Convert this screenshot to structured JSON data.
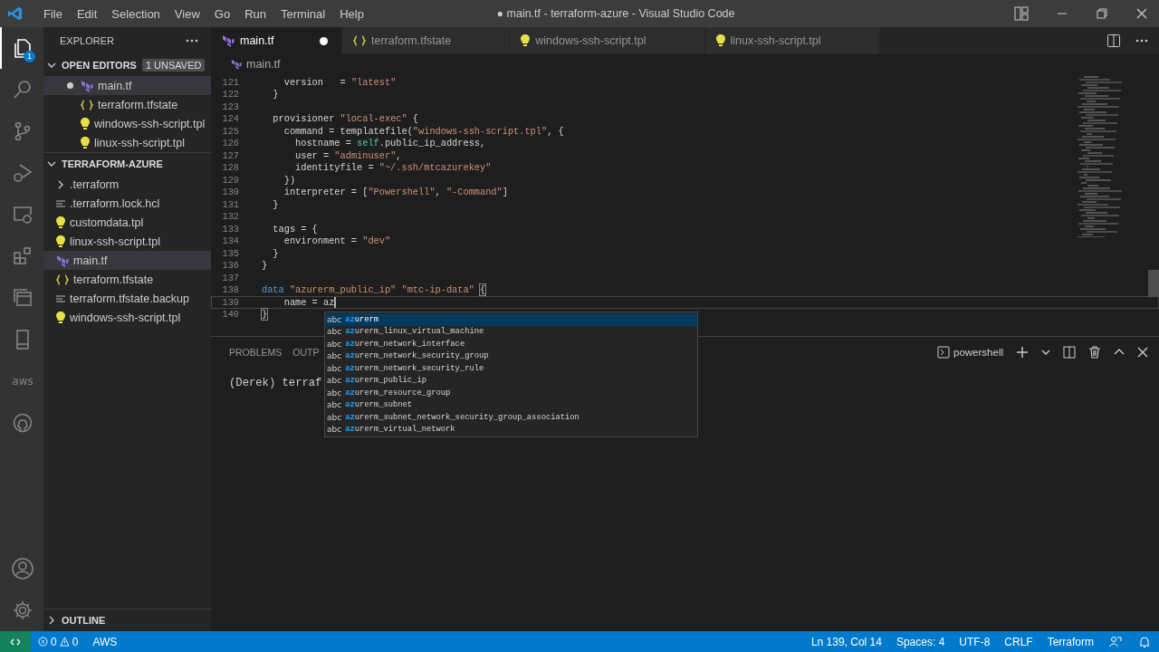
{
  "window": {
    "title": "● main.tf - terraform-azure - Visual Studio Code"
  },
  "menu": [
    "File",
    "Edit",
    "Selection",
    "View",
    "Go",
    "Run",
    "Terminal",
    "Help"
  ],
  "activity_bar": [
    {
      "kind": "explorer",
      "selected": true,
      "badge": "1"
    },
    {
      "kind": "search",
      "selected": false
    },
    {
      "kind": "source-control",
      "selected": false
    },
    {
      "kind": "run-debug",
      "selected": false
    },
    {
      "kind": "remote",
      "selected": false
    },
    {
      "kind": "extensions",
      "selected": false
    },
    {
      "kind": "panels",
      "selected": false
    },
    {
      "kind": "tablet",
      "selected": false
    },
    {
      "kind": "aws",
      "selected": false,
      "label": "aws"
    },
    {
      "kind": "github",
      "selected": false
    }
  ],
  "sidebar": {
    "title": "EXPLORER",
    "open_editors": {
      "title": "OPEN EDITORS",
      "badge": "1 UNSAVED",
      "expanded": true,
      "items": [
        {
          "name": "main.tf",
          "kind": "terraform",
          "unsaved": true,
          "selected": true
        },
        {
          "name": "terraform.tfstate",
          "kind": "json",
          "unsaved": false,
          "selected": false
        },
        {
          "name": "windows-ssh-script.tpl",
          "kind": "template",
          "unsaved": false,
          "selected": false
        },
        {
          "name": "linux-ssh-script.tpl",
          "kind": "template",
          "unsaved": false,
          "selected": false
        }
      ]
    },
    "folder": {
      "title": "TERRAFORM-AZURE",
      "expanded": true,
      "items": [
        {
          "name": ".terraform",
          "kind": "folder",
          "expanded": false,
          "selected": false
        },
        {
          "name": ".terraform.lock.hcl",
          "kind": "text",
          "selected": false
        },
        {
          "name": "customdata.tpl",
          "kind": "template",
          "selected": false
        },
        {
          "name": "linux-ssh-script.tpl",
          "kind": "template",
          "selected": false
        },
        {
          "name": "main.tf",
          "kind": "terraform",
          "selected": true
        },
        {
          "name": "terraform.tfstate",
          "kind": "json",
          "selected": false
        },
        {
          "name": "terraform.tfstate.backup",
          "kind": "text",
          "selected": false
        },
        {
          "name": "windows-ssh-script.tpl",
          "kind": "template",
          "selected": false
        }
      ]
    },
    "outline": {
      "title": "OUTLINE",
      "expanded": false
    }
  },
  "tabs": [
    {
      "name": "main.tf",
      "kind": "terraform",
      "selected": true,
      "unsaved": true
    },
    {
      "name": "terraform.tfstate",
      "kind": "json",
      "selected": false,
      "unsaved": false
    },
    {
      "name": "windows-ssh-script.tpl",
      "kind": "template",
      "selected": false,
      "unsaved": false
    },
    {
      "name": "linux-ssh-script.tpl",
      "kind": "template",
      "selected": false,
      "unsaved": false
    }
  ],
  "breadcrumb": {
    "name": "main.tf",
    "kind": "terraform"
  },
  "code": [
    {
      "number": "121",
      "current": false,
      "tokens": [
        {
          "kind": "plain",
          "text": "    version   = "
        },
        {
          "kind": "string",
          "text": "\"latest\""
        }
      ]
    },
    {
      "number": "122",
      "current": false,
      "tokens": [
        {
          "kind": "plain",
          "text": "  }"
        }
      ]
    },
    {
      "number": "123",
      "current": false
    },
    {
      "number": "124",
      "current": false,
      "tokens": [
        {
          "kind": "plain",
          "text": "  provisioner "
        },
        {
          "kind": "string",
          "text": "\"local-exec\""
        },
        {
          "kind": "plain",
          "text": " {"
        }
      ]
    },
    {
      "number": "125",
      "current": false,
      "tokens": [
        {
          "kind": "plain",
          "text": "    command = templatefile("
        },
        {
          "kind": "string",
          "text": "\"windows-ssh-script.tpl\""
        },
        {
          "kind": "plain",
          "text": ", {"
        }
      ]
    },
    {
      "number": "126",
      "current": false,
      "tokens": [
        {
          "kind": "plain",
          "text": "      hostname = "
        },
        {
          "kind": "variable",
          "text": "self"
        },
        {
          "kind": "plain",
          "text": ".public_ip_address,"
        }
      ]
    },
    {
      "number": "127",
      "current": false,
      "tokens": [
        {
          "kind": "plain",
          "text": "      user = "
        },
        {
          "kind": "string",
          "text": "\"adminuser\""
        },
        {
          "kind": "plain",
          "text": ","
        }
      ]
    },
    {
      "number": "128",
      "current": false,
      "tokens": [
        {
          "kind": "plain",
          "text": "      identityfile = "
        },
        {
          "kind": "string",
          "text": "\"~/.ssh/mtcazurekey\""
        }
      ]
    },
    {
      "number": "129",
      "current": false,
      "tokens": [
        {
          "kind": "plain",
          "text": "    })"
        }
      ]
    },
    {
      "number": "130",
      "current": false,
      "tokens": [
        {
          "kind": "plain",
          "text": "    interpreter = ["
        },
        {
          "kind": "string",
          "text": "\"Powershell\""
        },
        {
          "kind": "plain",
          "text": ", "
        },
        {
          "kind": "string",
          "text": "\"-Command\""
        },
        {
          "kind": "plain",
          "text": "]"
        }
      ]
    },
    {
      "number": "131",
      "current": false,
      "tokens": [
        {
          "kind": "plain",
          "text": "  }"
        }
      ]
    },
    {
      "number": "132",
      "current": false
    },
    {
      "number": "133",
      "current": false,
      "tokens": [
        {
          "kind": "plain",
          "text": "  tags = {"
        }
      ]
    },
    {
      "number": "134",
      "current": false,
      "tokens": [
        {
          "kind": "plain",
          "text": "    environment = "
        },
        {
          "kind": "string",
          "text": "\"dev\""
        }
      ]
    },
    {
      "number": "135",
      "current": false,
      "tokens": [
        {
          "kind": "plain",
          "text": "  }"
        }
      ]
    },
    {
      "number": "136",
      "current": false,
      "tokens": [
        {
          "kind": "plain",
          "text": "}"
        }
      ]
    },
    {
      "number": "137",
      "current": false
    },
    {
      "number": "138",
      "current": false,
      "tokens": [
        {
          "kind": "keyword",
          "text": "data"
        },
        {
          "kind": "string",
          "text": " \"azurerm_public_ip\""
        },
        {
          "kind": "string",
          "text": " \"mtc-ip-data\" "
        },
        {
          "kind": "bracket",
          "text": "{"
        }
      ]
    },
    {
      "number": "139",
      "current": true,
      "tokens": [
        {
          "kind": "plain",
          "text": "    name = az"
        }
      ]
    },
    {
      "number": "140",
      "current": false,
      "tokens": [
        {
          "kind": "bracket",
          "text": "}"
        }
      ]
    }
  ],
  "suggestions": [
    {
      "icon": "abc",
      "match": "az",
      "rest": "urerm",
      "selected": true
    },
    {
      "icon": "abc",
      "match": "az",
      "rest": "urerm_linux_virtual_machine",
      "selected": false
    },
    {
      "icon": "abc",
      "match": "az",
      "rest": "urerm_network_interface",
      "selected": false
    },
    {
      "icon": "abc",
      "match": "az",
      "rest": "urerm_network_security_group",
      "selected": false
    },
    {
      "icon": "abc",
      "match": "az",
      "rest": "urerm_network_security_rule",
      "selected": false
    },
    {
      "icon": "abc",
      "match": "az",
      "rest": "urerm_public_ip",
      "selected": false
    },
    {
      "icon": "abc",
      "match": "az",
      "rest": "urerm_resource_group",
      "selected": false
    },
    {
      "icon": "abc",
      "match": "az",
      "rest": "urerm_subnet",
      "selected": false
    },
    {
      "icon": "abc",
      "match": "az",
      "rest": "urerm_subnet_network_security_group_association",
      "selected": false
    },
    {
      "icon": "abc",
      "match": "az",
      "rest": "urerm_virtual_network",
      "selected": false
    }
  ],
  "panel": {
    "tabs": [
      {
        "label": "PROBLEMS",
        "selected": false
      },
      {
        "label": "OUTP",
        "selected": false
      }
    ],
    "terminal_name": "powershell",
    "terminal_text": "(Derek) terraf"
  },
  "status_bar": {
    "errors": "0",
    "warnings": "0",
    "left": [
      "AWS"
    ],
    "right": [
      "Ln 139, Col 14",
      "Spaces: 4",
      "UTF-8",
      "CRLF",
      "Terraform"
    ]
  }
}
